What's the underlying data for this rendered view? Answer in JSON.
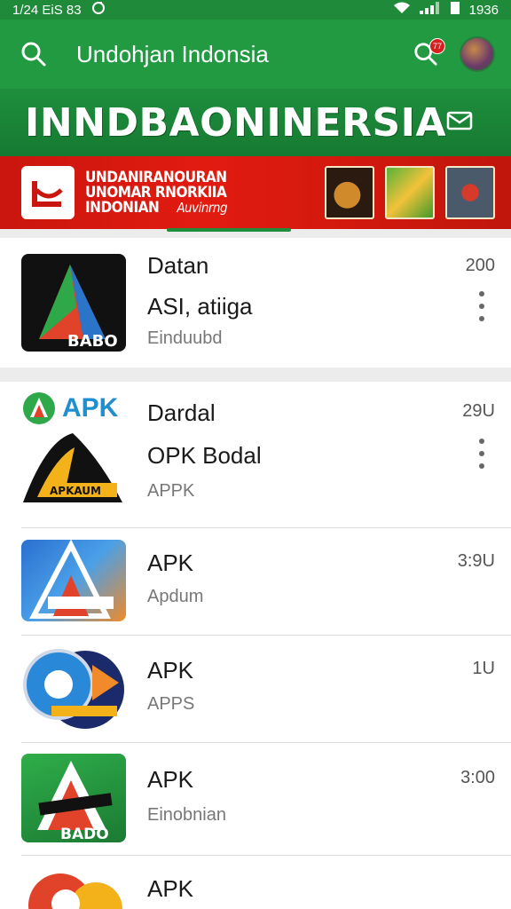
{
  "status_bar": {
    "time": "1/24 EiS 83",
    "clock": "1936"
  },
  "toolbar": {
    "query": "Undohjan Indonsia",
    "badge_count": "77"
  },
  "brand": {
    "title": "INNDBAONINERSIA"
  },
  "banner": {
    "line1": "UNDANIRANOURAN",
    "line2": "UNOMAR RNORKIIA",
    "line3": "INDONIAN",
    "cta": "Auvinrng"
  },
  "apps": [
    {
      "title": "Datan",
      "subtitle": "ASI, atiiga",
      "meta": "Einduubd",
      "size": "200"
    },
    {
      "label": "APK",
      "title": "Dardal",
      "subtitle": "OPK Bodal",
      "meta": "APPK",
      "size": "29U"
    },
    {
      "title": "APK",
      "meta": "Apdum",
      "size": "3:9U"
    },
    {
      "title": "APK",
      "meta": "APPS",
      "size": "1U"
    },
    {
      "title": "APK",
      "meta": "Einobnian",
      "size": "3:00"
    },
    {
      "title": "APK"
    }
  ],
  "colors": {
    "green": "#219a41",
    "red": "#e21b10",
    "accent_blue": "#1f8fd0"
  }
}
